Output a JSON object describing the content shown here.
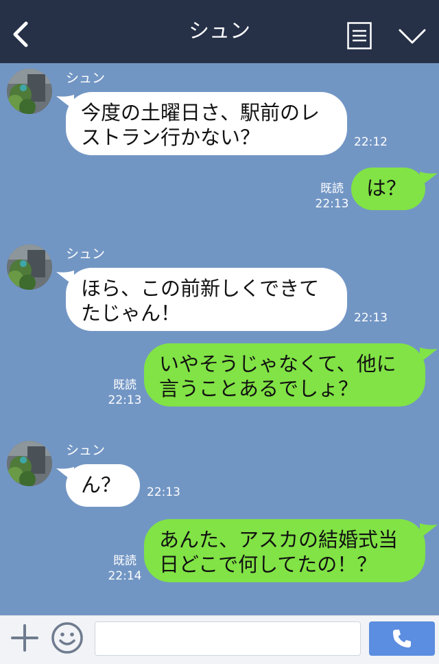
{
  "header": {
    "title": "シュン",
    "icons": [
      "back-icon",
      "menu-icon",
      "chevron-down-icon"
    ]
  },
  "messages": [
    {
      "side": "in",
      "sender": "シュン",
      "line1": "今度の土曜日さ、駅前のレ",
      "line2": "ストラン行かない？",
      "time": "22:12"
    },
    {
      "side": "out",
      "read": "既読",
      "line1": "は？",
      "time": "22:13"
    },
    {
      "side": "in",
      "sender": "シュン",
      "line1": "ほら、この前新しくできて",
      "line2": "たじゃん！",
      "time": "22:13"
    },
    {
      "side": "out",
      "read": "既読",
      "line1": "いやそうじゃなくて、他に",
      "line2": "言うことあるでしょ？",
      "time": "22:13"
    },
    {
      "side": "in",
      "sender": "シュン",
      "line1": "ん？",
      "time": "22:13"
    },
    {
      "side": "out",
      "read": "既読",
      "line1": "あんた、アスカの結婚式当",
      "line2": "日どこで何してたの！？",
      "time": "22:14"
    }
  ],
  "footer": {
    "input_value": "",
    "icons": [
      "plus-icon",
      "emoji-icon",
      "phone-icon"
    ]
  },
  "colors": {
    "header_bg": "#263148",
    "chat_bg": "#7296c4",
    "incoming_bubble": "#ffffff",
    "outgoing_bubble": "#81e345",
    "call_button": "#5b8de0"
  }
}
